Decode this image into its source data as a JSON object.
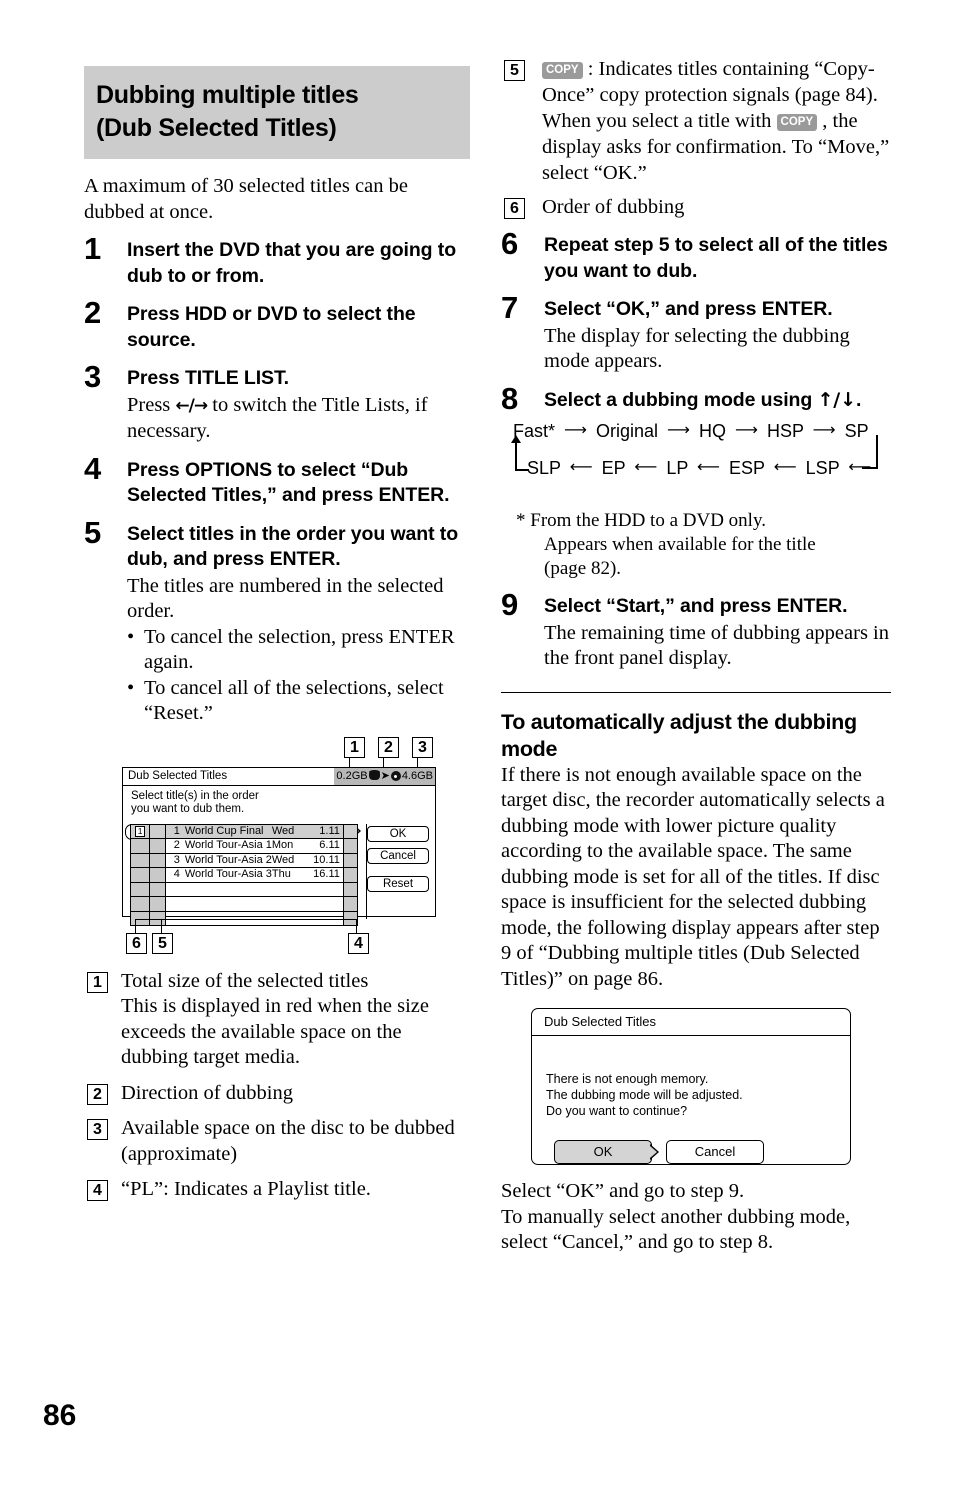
{
  "page_number": "86",
  "left_column": {
    "section_title_line1": "Dubbing multiple titles",
    "section_title_line2": "(Dub Selected Titles)",
    "intro": "A maximum of 30 selected titles can be dubbed at once.",
    "steps": [
      {
        "num": "1",
        "head": "Insert the DVD that you are going to dub to or from.",
        "body": ""
      },
      {
        "num": "2",
        "head": "Press HDD or DVD to select the source.",
        "body": ""
      },
      {
        "num": "3",
        "head": "Press TITLE LIST.",
        "body_pre": "Press ",
        "body_arrows": "←/→",
        "body_post": " to switch the Title Lists, if necessary."
      },
      {
        "num": "4",
        "head": "Press OPTIONS to select “Dub Selected Titles,” and press ENTER.",
        "body": ""
      },
      {
        "num": "5",
        "head": "Select titles in the order you want to dub, and press ENTER.",
        "body": "The titles are numbered in the selected order.",
        "bullets": [
          "To cancel the selection, press ENTER again.",
          "To cancel all of the selections, select “Reset.”"
        ]
      }
    ],
    "screen_mock": {
      "top_callouts": [
        "1",
        "2",
        "3"
      ],
      "bottom_callouts": [
        "6",
        "5",
        "4"
      ],
      "title": "Dub Selected Titles",
      "gauge_left": "0.2GB",
      "gauge_right": "4.6GB",
      "gauge_source_icon": "hdd-icon",
      "gauge_arrow_icon": "right-arrow-icon",
      "gauge_target_icon": "disc-icon",
      "instruction_line1": "Select title(s) in the order",
      "instruction_line2": "you want to dub them.",
      "selected_order_badge": "1",
      "rows": [
        {
          "no": "1",
          "name": "World Cup Final",
          "day": "Wed",
          "date": "1.11"
        },
        {
          "no": "2",
          "name": "World Tour-Asia 1",
          "day": "Mon",
          "date": "6.11"
        },
        {
          "no": "3",
          "name": "World Tour-Asia 2",
          "day": "Wed",
          "date": "10.11"
        },
        {
          "no": "4",
          "name": "World Tour-Asia 3",
          "day": "Thu",
          "date": "16.11"
        }
      ],
      "buttons": [
        "OK",
        "Cancel",
        "Reset"
      ]
    },
    "callouts": [
      {
        "num": "1",
        "title": "Total size of the selected titles",
        "desc": "This is displayed in red when the size exceeds the available space on the dubbing target media."
      },
      {
        "num": "2",
        "title": "Direction of dubbing",
        "desc": ""
      },
      {
        "num": "3",
        "title": "Available space on the disc to be dubbed (approximate)",
        "desc": ""
      },
      {
        "num": "4",
        "title": "“PL”: Indicates a Playlist title.",
        "desc": ""
      }
    ]
  },
  "right_column": {
    "callout5": {
      "num": "5",
      "badge": "COPY",
      "text_part1": " : Indicates titles containing “Copy-Once” copy protection signals (page 84). When you select a title with ",
      "text_part2": " , the display asks for confirmation. To “Move,” select “OK.”"
    },
    "callout6": {
      "num": "6",
      "text": "Order of dubbing"
    },
    "steps": [
      {
        "num": "6",
        "head": "Repeat step 5 to select all of the titles you want to dub.",
        "body": ""
      },
      {
        "num": "7",
        "head": "Select “OK,” and press ENTER.",
        "body": "The display for selecting the dubbing mode appears."
      },
      {
        "num": "8",
        "head_pre": "Select a dubbing mode using ",
        "head_arrows": "↑/↓",
        "head_post": "."
      },
      {
        "num": "9",
        "head": "Select “Start,” and press ENTER.",
        "body": "The remaining time of dubbing appears in the front panel display."
      }
    ],
    "mode_flow": {
      "top_row": [
        "Fast*",
        "Original",
        "HQ",
        "HSP",
        "SP"
      ],
      "bottom_row": [
        "SLP",
        "EP",
        "LP",
        "ESP",
        "LSP"
      ],
      "footnote_line1": "* From the HDD to a DVD only.",
      "footnote_line2": "Appears when available for the title",
      "footnote_line3": "(page 82)."
    },
    "auto_adjust": {
      "heading": "To automatically adjust the dubbing mode",
      "body": "If there is not enough available space on the target disc, the recorder automatically selects a dubbing mode with lower picture quality according to the available space. The same dubbing mode is set for all of the titles. If disc space is insufficient for the selected dubbing mode, the following display appears after step 9 of “Dubbing multiple titles (Dub Selected Titles)” on page 86."
    },
    "dialog_mock": {
      "title": "Dub Selected Titles",
      "message_line1": "There is not enough memory.",
      "message_line2": "The dubbing mode will be adjusted.",
      "message_line3": "Do you want to continue?",
      "ok_label": "OK",
      "cancel_label": "Cancel"
    },
    "tail_line1": "Select “OK” and go to step 9.",
    "tail_line2": "To manually select another dubbing mode, select “Cancel,” and go to step 8."
  }
}
